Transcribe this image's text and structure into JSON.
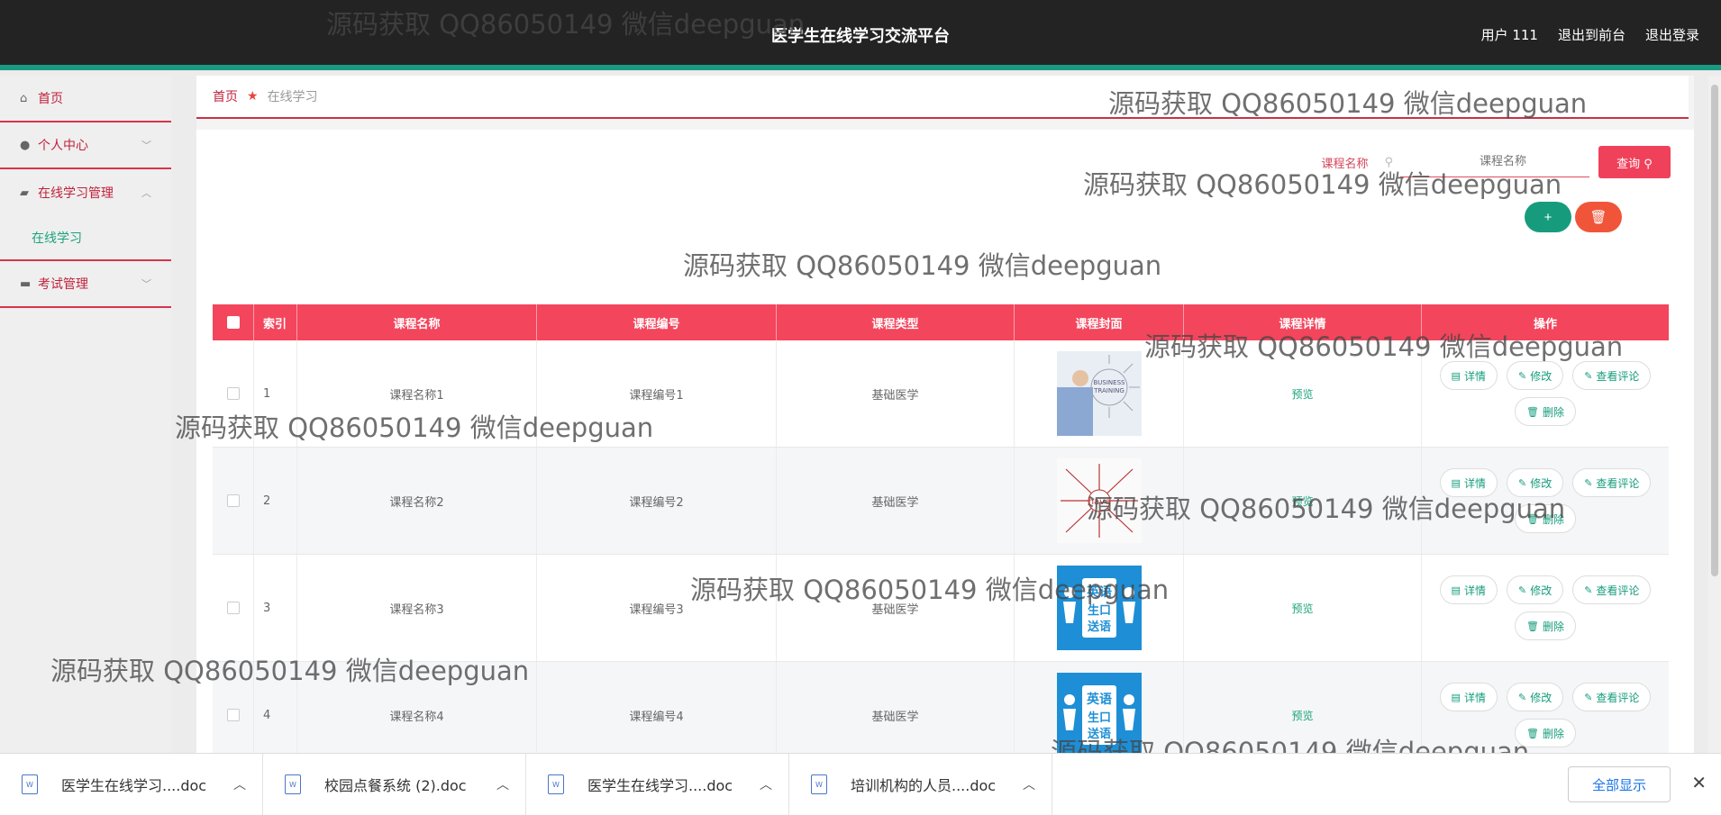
{
  "header": {
    "title": "医学生在线学习交流平台",
    "user": "用户 111",
    "to_frontend": "退出到前台",
    "logout": "退出登录"
  },
  "sidebar": {
    "items": [
      {
        "label": "首页",
        "icon": "home-icon"
      },
      {
        "label": "个人中心",
        "icon": "user-icon"
      },
      {
        "label": "在线学习管理",
        "icon": "ticket-icon",
        "children": [
          "在线学习"
        ]
      },
      {
        "label": "考试管理",
        "icon": "briefcase-icon"
      }
    ]
  },
  "breadcrumb": {
    "home": "首页",
    "current": "在线学习"
  },
  "search": {
    "label": "课程名称",
    "placeholder": "课程名称",
    "query_label": "查询",
    "add_label": "+",
    "delete_label": "🗑"
  },
  "table": {
    "headers": [
      "",
      "索引",
      "课程名称",
      "课程编号",
      "课程类型",
      "课程封面",
      "课程详情",
      "操作"
    ],
    "rows": [
      {
        "index": "1",
        "name": "课程名称1",
        "code": "课程编号1",
        "type": "基础医学",
        "detail": "预览",
        "cover": "business-training"
      },
      {
        "index": "2",
        "name": "课程名称2",
        "code": "课程编号2",
        "type": "基础医学",
        "detail": "预览",
        "cover": "have-mindmap"
      },
      {
        "index": "3",
        "name": "课程名称3",
        "code": "课程编号3",
        "type": "基础医学",
        "detail": "预览",
        "cover": "english-corner"
      },
      {
        "index": "4",
        "name": "课程名称4",
        "code": "课程编号4",
        "type": "基础医学",
        "detail": "预览",
        "cover": "english-corner"
      }
    ],
    "ops": {
      "detail": "详情",
      "edit": "修改",
      "review": "查看评论",
      "delete": "删除"
    }
  },
  "downloads": {
    "files": [
      "医学生在线学习....doc",
      "校园点餐系统 (2).doc",
      "医学生在线学习....doc",
      "培训机构的人员....doc"
    ],
    "show_all": "全部显示"
  },
  "watermark": "源码获取 QQ86050149 微信deepguan",
  "colors": {
    "accent": "#f3455c",
    "green": "#169c7c",
    "topbar": "#232323"
  }
}
